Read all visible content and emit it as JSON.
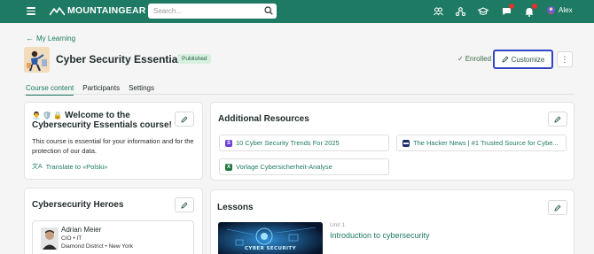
{
  "topbar": {
    "brand": "MOUNTAINGEAR",
    "search_placeholder": "Search...",
    "user_name": "Alex",
    "icons": [
      "people-icon",
      "org-icon",
      "graduation-cap-icon",
      "chat-icon",
      "bell-icon"
    ]
  },
  "header": {
    "back_label": "My Learning",
    "course_title": "Cyber Security Essentials",
    "status": "Published",
    "enrolled_label": "Enrolled",
    "customize_label": "Customize"
  },
  "tabs": [
    {
      "label": "Course content",
      "active": true
    },
    {
      "label": "Participants",
      "active": false
    },
    {
      "label": "Settings",
      "active": false
    }
  ],
  "welcome": {
    "emojis": "👨‍💼 🛡️ 🔒",
    "heading_line1": "Welcome to the",
    "heading_line2": "Cybersecurity Essentials course!",
    "body": "This course is essential for your information and for the protection of our data.",
    "translate_label": "Translate to «Polski»"
  },
  "resources": {
    "heading": "Additional Resources",
    "items": [
      {
        "label": "10 Cyber Security Trends For 2025",
        "icon": "document-icon",
        "color": "#6b3fd4"
      },
      {
        "label": "The Hacker News | #1 Trusted Source for Cybe...",
        "icon": "news-icon",
        "color": "#1d2d6b"
      },
      {
        "label": "Vorlage Cybersicherheit-Analyse",
        "icon": "spreadsheet-icon",
        "color": "#1f7a3f"
      }
    ]
  },
  "heroes": {
    "heading": "Cybersecurity Heroes",
    "person": {
      "name": "Adrian Meier",
      "role": "CIO • IT",
      "location": "Diamond District • New York"
    }
  },
  "lessons": {
    "heading": "Lessons",
    "items": [
      {
        "unit": "Unit 1",
        "title": "Introduction to cybersecurity",
        "thumb_text": "CYBER SECURITY"
      }
    ]
  },
  "colors": {
    "brand": "#1e7a63",
    "highlight": "#3345c5",
    "notification": "#e4312b"
  }
}
